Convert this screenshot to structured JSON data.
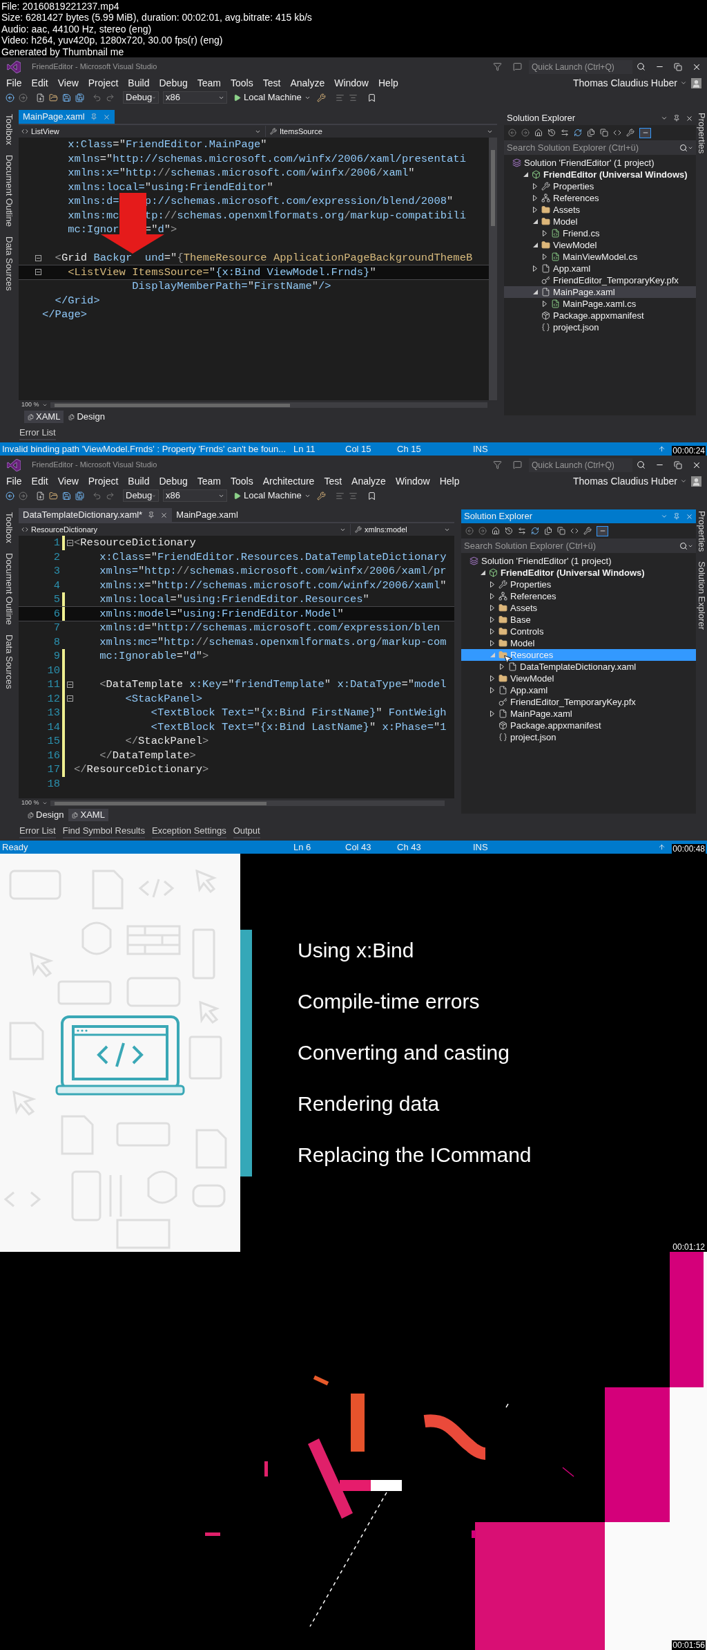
{
  "file_info": [
    "File: 20160819221237.mp4",
    "Size: 6281427 bytes (5.99 MiB), duration: 00:02:01, avg.bitrate: 415 kb/s",
    "Audio: aac, 44100 Hz, stereo (eng)",
    "Video: h264, yuv420p, 1280x720, 30.00 fps(r) (eng)",
    "Generated by Thumbnail me"
  ],
  "frames": [
    {
      "kind": "ide",
      "timestamp": "00:00:24",
      "window_title": "FriendEditor - Microsoft Visual Studio",
      "quick_launch": {
        "placeholder": "Quick Launch (Ctrl+Q)"
      },
      "user": "Thomas Claudius Huber",
      "menu": [
        "File",
        "Edit",
        "View",
        "Project",
        "Build",
        "Debug",
        "Team",
        "Tools",
        "Test",
        "Analyze",
        "Window",
        "Help"
      ],
      "toolbar": {
        "configuration": "Debug",
        "platform": "x86",
        "target": "Local Machine"
      },
      "left_tabs": [
        "Toolbox",
        "Document Outline",
        "Data Sources"
      ],
      "right_tabs": [
        "Properties"
      ],
      "doc_tabs": [
        {
          "label": "MainPage.xaml",
          "selected": true
        }
      ],
      "nav": {
        "element": "ListView",
        "member": "ItemsSource"
      },
      "editor": {
        "lines": [
          {
            "parts": [
              "    x:Class=\"FriendEditor.MainPage\""
            ],
            "fold": false,
            "current": false
          },
          {
            "parts": [
              "    xmlns=\"http://schemas.microsoft.com/winfx/2006/xaml/presentati"
            ],
            "fold": false,
            "current": false
          },
          {
            "parts": [
              "    xmlns:x=\"http://schemas.microsoft.com/winfx/2006/xaml\""
            ],
            "fold": false,
            "current": false
          },
          {
            "parts": [
              "    xmlns:local=\"using:FriendEditor\""
            ],
            "fold": false,
            "current": false
          },
          {
            "parts": [
              "    xmlns:d=",
              "p://schemas.microsoft.com/expression/blend/2008\""
            ],
            "fold": false,
            "current": false
          },
          {
            "parts": [
              "    xmlns:mc",
              "tp://schemas.openxmlformats.org/markup-compatibili"
            ],
            "fold": false,
            "current": false
          },
          {
            "parts": [
              "    mc:Ignor",
              "=\"d\">"
            ],
            "fold": false,
            "current": false
          },
          {
            "fold": false,
            "current": false
          },
          {
            "parts": [
              "  <Grid Backgr",
              "und=\"{ThemeResource ApplicationPageBackgroundThemeB"
            ],
            "fold": true,
            "current": false
          },
          {
            "parts": [
              "    <ListView ItemsSource=\"{x:Bind ViewModel.Frnds}\""
            ],
            "fold": true,
            "current": true
          },
          {
            "parts": [
              "              DisplayMemberPath=\"FirstName\"/>"
            ],
            "fold": false,
            "current": false
          },
          {
            "parts": [
              "  </Grid>"
            ],
            "fold": false,
            "current": false
          },
          {
            "parts": [
              "</Page>"
            ],
            "fold": false,
            "current": false
          }
        ],
        "zoom": "100 %"
      },
      "view_tabs": [
        {
          "label": "XAML",
          "selected": true
        },
        {
          "label": "Design",
          "selected": false
        }
      ],
      "bottom_tabs": [
        "Error List"
      ],
      "status": {
        "message": "Invalid binding path 'ViewModel.Frnds' : Property 'Frnds' can't be foun...",
        "line": "Ln 11",
        "column": "Col 15",
        "char": "Ch 15",
        "mode": "INS"
      },
      "solution_explorer": {
        "title": "Solution Explorer",
        "focused": false,
        "search": {
          "placeholder": "Search Solution Explorer (Ctrl+ü)"
        },
        "tree": [
          {
            "label": "Solution 'FriendEditor' (1 project)",
            "kind": "solution",
            "selected": false,
            "children": [
              {
                "label": "FriendEditor (Universal Windows)",
                "kind": "project",
                "expanded": true,
                "selected": false,
                "children": [
                  {
                    "label": "Properties",
                    "kind": "wrench",
                    "expanded": false,
                    "selected": false
                  },
                  {
                    "label": "References",
                    "kind": "references",
                    "expanded": false,
                    "selected": false
                  },
                  {
                    "label": "Assets",
                    "kind": "folder",
                    "expanded": false,
                    "selected": false
                  },
                  {
                    "label": "Model",
                    "kind": "folder",
                    "expanded": true,
                    "selected": false,
                    "children": [
                      {
                        "label": "Friend.cs",
                        "kind": "code",
                        "expanded": false,
                        "selected": false
                      }
                    ]
                  },
                  {
                    "label": "ViewModel",
                    "kind": "folder",
                    "expanded": true,
                    "selected": false,
                    "children": [
                      {
                        "label": "MainViewModel.cs",
                        "kind": "code",
                        "expanded": false,
                        "selected": false
                      }
                    ]
                  },
                  {
                    "label": "App.xaml",
                    "kind": "file",
                    "expanded": false,
                    "selected": false
                  },
                  {
                    "label": "FriendEditor_TemporaryKey.pfx",
                    "kind": "key",
                    "selected": false
                  },
                  {
                    "label": "MainPage.xaml",
                    "kind": "file",
                    "expanded": true,
                    "selected": true,
                    "children": [
                      {
                        "label": "MainPage.xaml.cs",
                        "kind": "code",
                        "expanded": false,
                        "selected": false
                      }
                    ]
                  },
                  {
                    "label": "Package.appxmanifest",
                    "kind": "package",
                    "selected": false
                  },
                  {
                    "label": "project.json",
                    "kind": "braces",
                    "selected": false
                  }
                ]
              }
            ]
          }
        ]
      }
    },
    {
      "kind": "ide",
      "timestamp": "00:00:48",
      "window_title": "FriendEditor - Microsoft Visual Studio",
      "quick_launch": {
        "placeholder": "Quick Launch (Ctrl+Q)"
      },
      "user": "Thomas Claudius Huber",
      "menu": [
        "File",
        "Edit",
        "View",
        "Project",
        "Build",
        "Debug",
        "Team",
        "Tools",
        "Architecture",
        "Test",
        "Analyze",
        "Window",
        "Help"
      ],
      "toolbar": {
        "configuration": "Debug",
        "platform": "x86",
        "target": "Local Machine"
      },
      "left_tabs": [
        "Toolbox",
        "Document Outline",
        "Data Sources"
      ],
      "right_tabs": [
        "Properties",
        "Solution Explorer"
      ],
      "doc_tabs": [
        {
          "label": "DataTemplateDictionary.xaml*",
          "selected": true
        },
        {
          "label": "MainPage.xaml",
          "selected": false
        }
      ],
      "nav": {
        "element": "ResourceDictionary",
        "member": "xmlns:model"
      },
      "editor": {
        "lines": [
          {
            "number": "1",
            "parts": [
              "<ResourceDictionary"
            ],
            "fold": true,
            "changed": true,
            "current": false
          },
          {
            "number": "2",
            "parts": [
              "    x:Class=\"FriendEditor.Resources.DataTemplateDictionary"
            ],
            "fold": false,
            "changed": false,
            "current": false
          },
          {
            "number": "3",
            "parts": [
              "    xmlns=\"http://schemas.microsoft.com/winfx/2006/xaml/pr"
            ],
            "fold": false,
            "changed": false,
            "current": false
          },
          {
            "number": "4",
            "parts": [
              "    xmlns:x=\"http://schemas.microsoft.com/winfx/2006/xaml\""
            ],
            "fold": false,
            "changed": false,
            "current": false
          },
          {
            "number": "5",
            "parts": [
              "    xmlns:local=\"using:FriendEditor.Resources\""
            ],
            "fold": false,
            "changed": true,
            "current": false
          },
          {
            "number": "6",
            "parts": [
              "    xmlns:model=\"using:FriendEditor.Model\""
            ],
            "fold": false,
            "changed": true,
            "current": true
          },
          {
            "number": "7",
            "parts": [
              "    xmlns:d=\"http://schemas.microsoft.com/expression/blen"
            ],
            "fold": false,
            "changed": false,
            "current": false
          },
          {
            "number": "8",
            "parts": [
              "    xmlns:mc=\"http://schemas.openxmlformats.org/markup-com"
            ],
            "fold": false,
            "changed": false,
            "current": false
          },
          {
            "number": "9",
            "parts": [
              "    mc:Ignorable=\"d\">"
            ],
            "fold": false,
            "changed": true,
            "current": false
          },
          {
            "number": "10",
            "fold": false,
            "changed": true,
            "current": false
          },
          {
            "number": "11",
            "parts": [
              "    <DataTemplate x:Key=\"friendTemplate\" x:DataType=\"model"
            ],
            "fold": true,
            "changed": true,
            "current": false
          },
          {
            "number": "12",
            "parts": [
              "        <StackPanel>"
            ],
            "fold": true,
            "changed": true,
            "current": false
          },
          {
            "number": "13",
            "parts": [
              "            <TextBlock Text=\"{x:Bind FirstName}\" FontWeigh"
            ],
            "fold": false,
            "changed": true,
            "current": false
          },
          {
            "number": "14",
            "parts": [
              "            <TextBlock Text=\"{x:Bind LastName}\" x:Phase=\"1"
            ],
            "fold": false,
            "changed": true,
            "current": false
          },
          {
            "number": "15",
            "parts": [
              "        </StackPanel>"
            ],
            "fold": false,
            "changed": true,
            "current": false
          },
          {
            "number": "16",
            "parts": [
              "    </DataTemplate>"
            ],
            "fold": false,
            "changed": true,
            "current": false
          },
          {
            "number": "17",
            "parts": [
              "</ResourceDictionary>"
            ],
            "fold": false,
            "changed": true,
            "current": false
          },
          {
            "number": "18",
            "fold": false,
            "changed": false,
            "current": false
          }
        ],
        "zoom": "100 %"
      },
      "view_tabs": [
        {
          "label": "Design",
          "selected": false
        },
        {
          "label": "XAML",
          "selected": true
        }
      ],
      "bottom_tabs": [
        "Error List",
        "Find Symbol Results",
        "Exception Settings",
        "Output"
      ],
      "status": {
        "message": "Ready",
        "line": "Ln 6",
        "column": "Col 43",
        "char": "Ch 43",
        "mode": "INS"
      },
      "solution_explorer": {
        "title": "Solution Explorer",
        "focused": true,
        "search": {
          "placeholder": "Search Solution Explorer (Ctrl+ü)"
        },
        "tree": [
          {
            "label": "Solution 'FriendEditor' (1 project)",
            "kind": "solution",
            "selected": false,
            "children": [
              {
                "label": "FriendEditor (Universal Windows)",
                "kind": "project",
                "expanded": true,
                "selected": false,
                "children": [
                  {
                    "label": "Properties",
                    "kind": "wrench",
                    "expanded": false,
                    "selected": false
                  },
                  {
                    "label": "References",
                    "kind": "references",
                    "expanded": false,
                    "selected": false
                  },
                  {
                    "label": "Assets",
                    "kind": "folder",
                    "expanded": false,
                    "selected": false
                  },
                  {
                    "label": "Base",
                    "kind": "folder",
                    "expanded": false,
                    "selected": false
                  },
                  {
                    "label": "Controls",
                    "kind": "folder",
                    "expanded": false,
                    "selected": false
                  },
                  {
                    "label": "Model",
                    "kind": "folder",
                    "expanded": false,
                    "selected": false
                  },
                  {
                    "label": "Resources",
                    "kind": "folder",
                    "expanded": true,
                    "selected": true,
                    "children": [
                      {
                        "label": "DataTemplateDictionary.xaml",
                        "kind": "file",
                        "expanded": false,
                        "selected": false
                      }
                    ]
                  },
                  {
                    "label": "ViewModel",
                    "kind": "folder",
                    "expanded": false,
                    "selected": false
                  },
                  {
                    "label": "App.xaml",
                    "kind": "file",
                    "expanded": false,
                    "selected": false
                  },
                  {
                    "label": "FriendEditor_TemporaryKey.pfx",
                    "kind": "key",
                    "selected": false
                  },
                  {
                    "label": "MainPage.xaml",
                    "kind": "file",
                    "expanded": false,
                    "selected": false
                  },
                  {
                    "label": "Package.appxmanifest",
                    "kind": "package",
                    "selected": false
                  },
                  {
                    "label": "project.json",
                    "kind": "braces",
                    "selected": false
                  }
                ]
              }
            ]
          }
        ]
      }
    },
    {
      "kind": "slide",
      "timestamp": "00:01:12",
      "bullets": [
        "Using x:Bind",
        "Compile-time errors",
        "Converting and casting",
        "Rendering data",
        "Replacing the ICommand"
      ]
    },
    {
      "kind": "picture",
      "timestamp": "00:01:56"
    }
  ]
}
